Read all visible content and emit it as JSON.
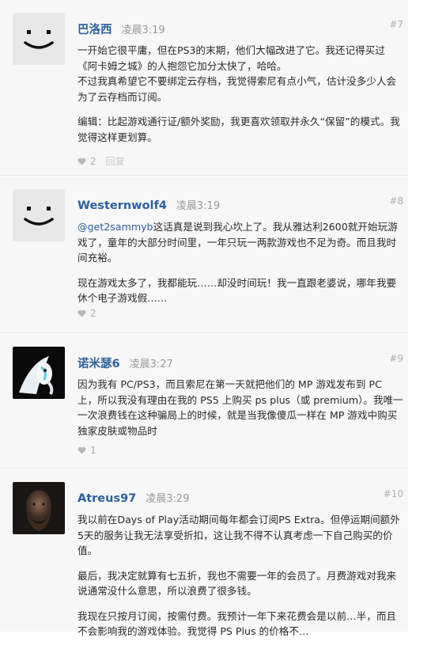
{
  "posts": [
    {
      "username": "巴洛西",
      "time": "凌晨3:19",
      "number": "#7",
      "avatar": "smiley-face-avatar",
      "paragraphs": [
        "一开始它很平庸，但在PS3的末期，他们大幅改进了它。我还记得买过《阿卡姆之城》的人抱怨它加分太快了，哈哈。\n不过我真希望它不要绑定云存档，我觉得索尼有点小气，估计没多少人会为了云存档而订阅。",
        "编辑：比起游戏通行证/额外奖励，我更喜欢领取并永久“保留”的模式。我觉得这样更划算。"
      ],
      "likes": "2",
      "reply_label": "回复"
    },
    {
      "username": "Westernwolf4",
      "time": "凌晨3:19",
      "number": "#8",
      "avatar": "smiley-face-avatar",
      "mention": "@get2sammyb",
      "paragraphs": [
        "这话真是说到我心坎上了。我从雅达利2600就开始玩游戏了，童年的大部分时间里，一年只玩一两款游戏也不足为奇。而且我时间充裕。",
        "现在游戏太多了，我都能玩……却没时间玩！我一直跟老婆说，哪年我要休个电子游戏假……"
      ],
      "likes": "2"
    },
    {
      "username": "诺米瑟6",
      "time": "凌晨3:27",
      "number": "#9",
      "avatar": "white-robot-character-avatar",
      "paragraphs": [
        "因为我有 PC/PS3，而且索尼在第一天就把他们的 MP 游戏发布到 PC 上，所以我没有理由在我的 PS5 上购买 ps plus（或 premium）。我唯一一次浪费钱在这种骗局上的时候，就是当我像傻瓜一样在 MP 游戏中购买独家皮肤或物品时"
      ],
      "likes": "1"
    },
    {
      "username": "Atreus97",
      "time": "凌晨3:29",
      "number": "#10",
      "avatar": "bearded-man-photo-avatar",
      "paragraphs": [
        "我以前在Days of Play活动期间每年都会订阅PS Extra。但停运期间额外5天的服务让我无法享受折扣，这让我不得不认真考虑一下自己购买的价值。",
        "最后，我决定就算有七五折，我也不需要一年的会员了。月费游戏对我来说通常没什么意思，所以浪费了很多钱。",
        "我现在只按月订阅，按需付费。我预计一年下来花费会是以前…半，而且不会影响我的游戏体验。我觉得 PS Plus 的价格不…"
      ]
    }
  ],
  "colors": {
    "username": "#2b5f9e",
    "background": "#f7f7f7"
  }
}
